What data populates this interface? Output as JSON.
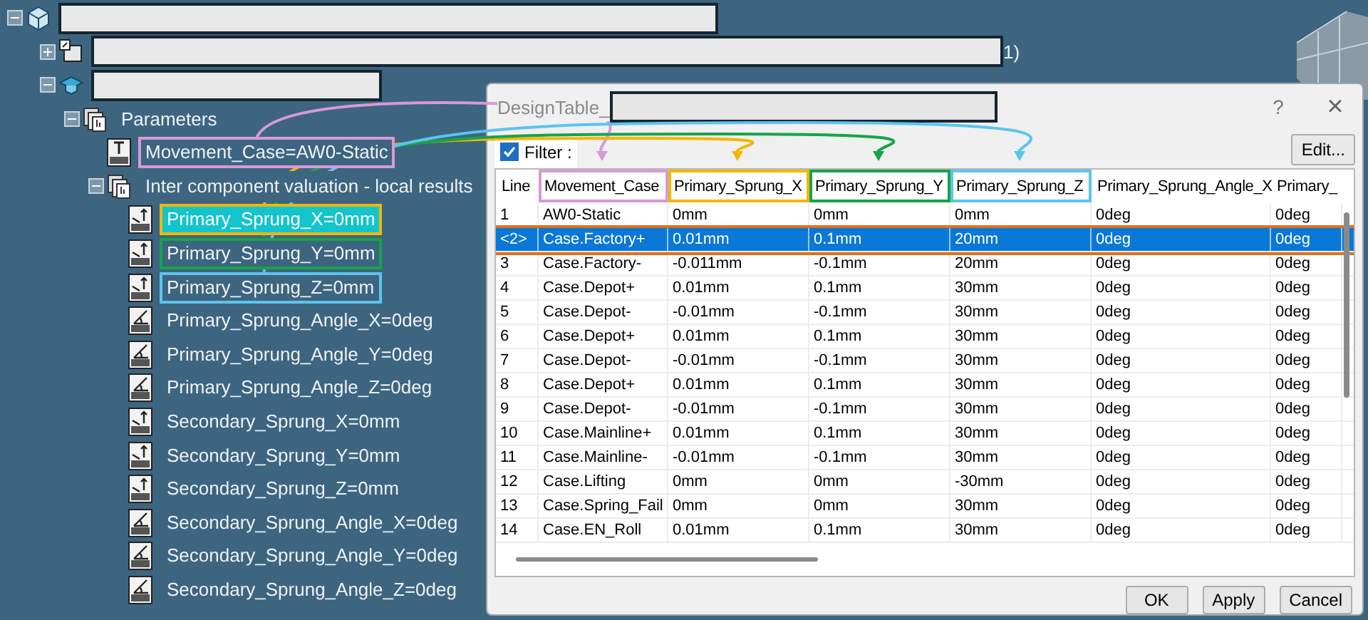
{
  "tree": {
    "nodes": [
      {
        "kind": "product",
        "expanded": true,
        "children": [
          {
            "kind": "component",
            "expanded": false,
            "label_tail": "1)"
          },
          {
            "kind": "part",
            "expanded": true,
            "children": [
              {
                "kind": "parameter-set",
                "label": "Parameters",
                "expanded": true,
                "children": [
                  {
                    "kind": "text-parameter",
                    "label": "Movement_Case=AW0-Static",
                    "color": "#d79ad6",
                    "selected": false
                  },
                  {
                    "kind": "parameter-set",
                    "label": "Inter component valuation - local results",
                    "expanded": true,
                    "children": [
                      {
                        "kind": "length-parameter",
                        "label": "Primary_Sprung_X=0mm",
                        "color": "#f2b705",
                        "selected": true
                      },
                      {
                        "kind": "length-parameter",
                        "label": "Primary_Sprung_Y=0mm",
                        "color": "#17a34a",
                        "selected": false
                      },
                      {
                        "kind": "length-parameter",
                        "label": "Primary_Sprung_Z=0mm",
                        "color": "#5cc4ee",
                        "selected": false
                      },
                      {
                        "kind": "angle-parameter",
                        "label": "Primary_Sprung_Angle_X=0deg",
                        "selected": false
                      },
                      {
                        "kind": "angle-parameter",
                        "label": "Primary_Sprung_Angle_Y=0deg",
                        "selected": false
                      },
                      {
                        "kind": "angle-parameter",
                        "label": "Primary_Sprung_Angle_Z=0deg",
                        "selected": false
                      },
                      {
                        "kind": "length-parameter",
                        "label": "Secondary_Sprung_X=0mm",
                        "selected": false
                      },
                      {
                        "kind": "length-parameter",
                        "label": "Secondary_Sprung_Y=0mm",
                        "selected": false
                      },
                      {
                        "kind": "length-parameter",
                        "label": "Secondary_Sprung_Z=0mm",
                        "selected": false
                      },
                      {
                        "kind": "angle-parameter",
                        "label": "Secondary_Sprung_Angle_X=0deg",
                        "selected": false
                      },
                      {
                        "kind": "angle-parameter",
                        "label": "Secondary_Sprung_Angle_Y=0deg",
                        "selected": false
                      },
                      {
                        "kind": "angle-parameter",
                        "label": "Secondary_Sprung_Angle_Z=0deg",
                        "selected": false
                      }
                    ]
                  }
                ]
              }
            ]
          }
        ]
      }
    ]
  },
  "dialog": {
    "title": "DesignTable_",
    "help": "?",
    "close": "×",
    "filter": {
      "label": "Filter :",
      "checked": true
    },
    "edit_button": "Edit...",
    "table": {
      "columns": [
        {
          "label": "Line"
        },
        {
          "label": "Movement_Case",
          "color": "#d79ad6"
        },
        {
          "label": "Primary_Sprung_X",
          "color": "#f2b705"
        },
        {
          "label": "Primary_Sprung_Y",
          "color": "#17a34a"
        },
        {
          "label": "Primary_Sprung_Z",
          "color": "#5cc4ee"
        },
        {
          "label": "Primary_Sprung_Angle_X"
        },
        {
          "label": "Primary_"
        }
      ],
      "rows": [
        {
          "cells": [
            "1",
            "AW0-Static",
            "0mm",
            "0mm",
            "0mm",
            "0deg",
            "0deg"
          ],
          "selected": false
        },
        {
          "cells": [
            "<2>",
            "Case.Factory+",
            "0.01mm",
            "0.1mm",
            "20mm",
            "0deg",
            "0deg"
          ],
          "selected": true
        },
        {
          "cells": [
            "3",
            "Case.Factory-",
            "-0.011mm",
            "-0.1mm",
            "20mm",
            "0deg",
            "0deg"
          ],
          "selected": false
        },
        {
          "cells": [
            "4",
            "Case.Depot+",
            "0.01mm",
            "0.1mm",
            "30mm",
            "0deg",
            "0deg"
          ],
          "selected": false
        },
        {
          "cells": [
            "5",
            "Case.Depot-",
            "-0.01mm",
            "-0.1mm",
            "30mm",
            "0deg",
            "0deg"
          ],
          "selected": false
        },
        {
          "cells": [
            "6",
            "Case.Depot+",
            "0.01mm",
            "0.1mm",
            "30mm",
            "0deg",
            "0deg"
          ],
          "selected": false
        },
        {
          "cells": [
            "7",
            "Case.Depot-",
            "-0.01mm",
            "-0.1mm",
            "30mm",
            "0deg",
            "0deg"
          ],
          "selected": false
        },
        {
          "cells": [
            "8",
            "Case.Depot+",
            "0.01mm",
            "0.1mm",
            "30mm",
            "0deg",
            "0deg"
          ],
          "selected": false
        },
        {
          "cells": [
            "9",
            "Case.Depot-",
            "-0.01mm",
            "-0.1mm",
            "30mm",
            "0deg",
            "0deg"
          ],
          "selected": false
        },
        {
          "cells": [
            "10",
            "Case.Mainline+",
            "0.01mm",
            "0.1mm",
            "30mm",
            "0deg",
            "0deg"
          ],
          "selected": false
        },
        {
          "cells": [
            "11",
            "Case.Mainline-",
            "-0.01mm",
            "-0.1mm",
            "30mm",
            "0deg",
            "0deg"
          ],
          "selected": false
        },
        {
          "cells": [
            "12",
            "Case.Lifting",
            "0mm",
            "0mm",
            "-30mm",
            "0deg",
            "0deg"
          ],
          "selected": false
        },
        {
          "cells": [
            "13",
            "Case.Spring_Fail",
            "0mm",
            "0mm",
            "30mm",
            "0deg",
            "0deg"
          ],
          "selected": false
        },
        {
          "cells": [
            "14",
            "Case.EN_Roll",
            "0.01mm",
            "0.1mm",
            "30mm",
            "0deg",
            "0deg"
          ],
          "selected": false
        }
      ]
    },
    "buttons": [
      "OK",
      "Apply",
      "Cancel"
    ]
  }
}
